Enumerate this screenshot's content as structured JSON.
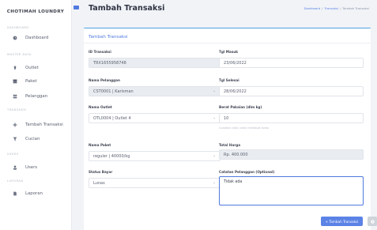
{
  "brand": "CHOTIMAH LOUNDRY",
  "sidebar": {
    "sections": [
      "DASHBOARD",
      "MASTER DATA",
      "TRANSAKSI",
      "USERS",
      "LAPORAN"
    ],
    "items": [
      {
        "label": "Dashboard",
        "icon": "dashboard-icon"
      },
      {
        "label": "Outlet",
        "icon": "outlet-icon"
      },
      {
        "label": "Paket",
        "icon": "package-icon"
      },
      {
        "label": "Pelanggan",
        "icon": "customers-icon"
      },
      {
        "label": "Tambah Transaksi",
        "icon": "add-transaction-icon"
      },
      {
        "label": "Cucian",
        "icon": "laundry-icon"
      },
      {
        "label": "Users",
        "icon": "user-icon"
      },
      {
        "label": "Laporan",
        "icon": "report-icon"
      }
    ]
  },
  "header": {
    "title": "Tambah Transaksi",
    "breadcrumb": [
      "Dashboard",
      "Transaksi",
      "Tambah Transaksi"
    ]
  },
  "form": {
    "card_title": "Tambah Transaksi",
    "id_transaksi": {
      "label": "ID Transaksi",
      "value": "TRX1655958748"
    },
    "tgl_masuk": {
      "label": "Tgl Masuk",
      "value": "23/06/2022"
    },
    "nama_pelanggan": {
      "label": "Nama Pelanggan",
      "value": "CST0001 | Karisman"
    },
    "tgl_selesai": {
      "label": "Tgl Selesai",
      "value": "28/06/2022"
    },
    "nama_outlet": {
      "label": "Nama Outlet",
      "value": "OTL0004 | Outlet 4"
    },
    "berat_pakaian": {
      "label": "Berat Pakaian (dlm kg)",
      "value": "10",
      "help": "Gunakan (dot) untuk membuat koma"
    },
    "nama_paket": {
      "label": "Nama Paket",
      "value": "reguler | 40000/kg"
    },
    "total_harga": {
      "label": "Total Harga",
      "value": "Rp. 400.000"
    },
    "status_bayar": {
      "label": "Status Bayar",
      "value": "Lunas"
    },
    "catatan": {
      "label": "Catatan Pelanggan (Optional)",
      "value": "Tidak ada"
    },
    "submit_label": "+ Tambah Transaksi"
  },
  "colors": {
    "accent": "#4f79e0",
    "card_top": "#4fa3e0"
  }
}
